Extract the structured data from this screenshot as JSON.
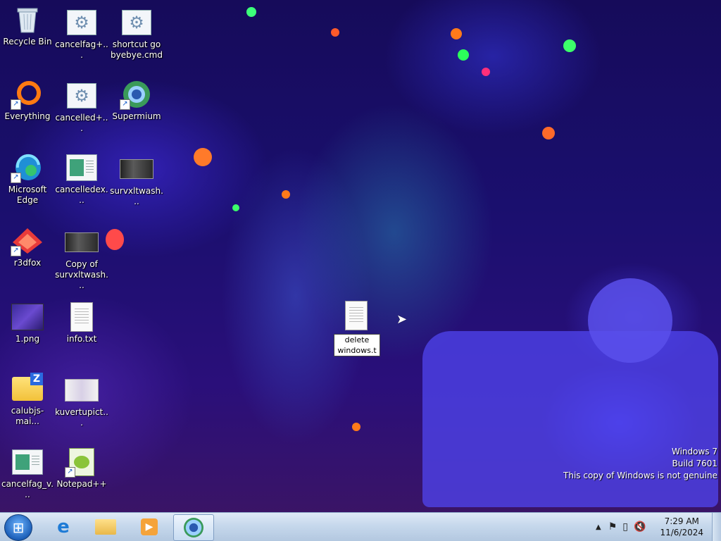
{
  "desktop_icons": {
    "recycle_bin": "Recycle Bin",
    "cancelfag_plus": "cancelfag+...",
    "shortcut_gobyebye": "shortcut go byebye.cmd",
    "everything": "Everything",
    "cancelled_plus": "cancelled+...",
    "supermium": "Supermium",
    "microsoft_edge": "Microsoft Edge",
    "cancelledex": "cancelledex...",
    "survxltwash": "survxltwash...",
    "r3dfox": "r3dfox",
    "copy_of_survxltwash": "Copy of survxltwash...",
    "png_1": "1.png",
    "info_txt": "info.txt",
    "calubjs": "calubjs-mai...",
    "kuvertupict": "kuvertupict...",
    "cancelfag_v": "cancelfag_v...",
    "notepadpp": "Notepad++"
  },
  "rename_field": {
    "value": "delete windows.t"
  },
  "watermark": {
    "line1": "Windows 7",
    "line2": "Build 7601",
    "line3": "This copy of Windows is not genuine"
  },
  "taskbar": {
    "pinned": [
      "start-orb",
      "internet-explorer-icon",
      "windows-explorer-icon",
      "media-player-icon",
      "supermium-icon"
    ],
    "clock_time": "7:29 AM",
    "clock_date": "11/6/2024"
  },
  "colors": {
    "taskbar_top": "#dfeaf6",
    "taskbar_bottom": "#b3c8e0",
    "desktop_base": "#1a0f6e"
  }
}
